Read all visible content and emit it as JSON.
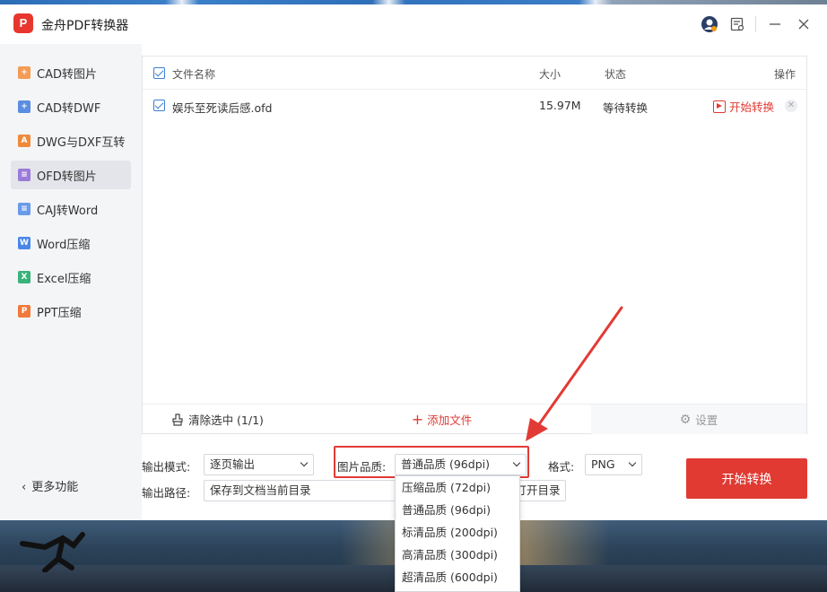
{
  "app": {
    "title": "金舟PDF转换器",
    "logo_text": "P"
  },
  "titlebar": {
    "icons": [
      "avatar-icon",
      "feedback-icon",
      "minimize-icon",
      "close-icon"
    ]
  },
  "sidebar": {
    "items": [
      {
        "label": "CAD转图片",
        "icon": "cad-image-icon",
        "color": "#f39c55"
      },
      {
        "label": "CAD转DWF",
        "icon": "cad-dwf-icon",
        "color": "#5b8de0"
      },
      {
        "label": "DWG与DXF互转",
        "icon": "dwg-dxf-icon",
        "color": "#f08a3b"
      },
      {
        "label": "OFD转图片",
        "icon": "ofd-image-icon",
        "color": "#9b7ad8"
      },
      {
        "label": "CAJ转Word",
        "icon": "caj-word-icon",
        "color": "#6a9be8"
      },
      {
        "label": "Word压缩",
        "icon": "word-compress-icon",
        "color": "#4a86e8"
      },
      {
        "label": "Excel压缩",
        "icon": "excel-compress-icon",
        "color": "#3bb27a"
      },
      {
        "label": "PPT压缩",
        "icon": "ppt-compress-icon",
        "color": "#f07a3b"
      }
    ],
    "active_index": 3,
    "more_label": "更多功能"
  },
  "file_list": {
    "columns": {
      "name": "文件名称",
      "size": "大小",
      "status": "状态",
      "action": "操作"
    },
    "rows": [
      {
        "name": "娱乐至死读后感.ofd",
        "size": "15.97M",
        "status": "等待转换",
        "action": "开始转换"
      }
    ],
    "footer": {
      "clear": "清除选中 (1/1)",
      "add": "添加文件",
      "settings": "设置"
    }
  },
  "settings": {
    "output_mode_label": "输出模式:",
    "output_mode_value": "逐页输出",
    "quality_label": "图片品质:",
    "quality_value": "普通品质 (96dpi)",
    "format_label": "格式:",
    "format_value": "PNG",
    "path_label": "输出路径:",
    "path_value": "保存到文档当前目录",
    "open_dir_label": "打开目录",
    "start_button": "开始转换"
  },
  "quality_options": [
    "压缩品质 (72dpi)",
    "普通品质 (96dpi)",
    "标清品质 (200dpi)",
    "高清品质 (300dpi)",
    "超清品质 (600dpi)"
  ],
  "colors": {
    "accent": "#e03a32",
    "checkbox": "#3a7fd5",
    "annotation": "#e23a34"
  }
}
